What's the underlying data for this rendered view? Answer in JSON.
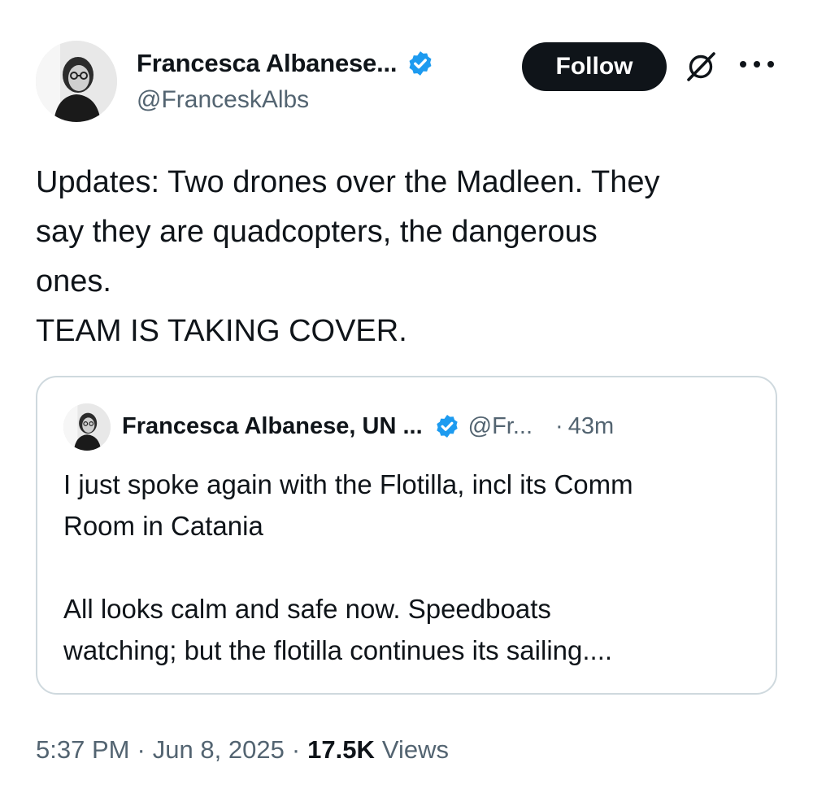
{
  "author": {
    "display_name": "Francesca Albanese...",
    "handle": "@FranceskAlbs",
    "verified": true,
    "verified_color": "#1d9bf0"
  },
  "actions": {
    "follow_label": "Follow",
    "grok_icon": "grok-icon",
    "more_icon": "more-icon"
  },
  "tweet": {
    "text": "Updates: Two drones over the Madleen. They\nsay they are quadcopters, the dangerous\nones.\nTEAM IS TAKING COVER."
  },
  "quote": {
    "display_name": "Francesca Albanese, UN ...",
    "handle": "@Fr...",
    "separator": "·",
    "time": "43m",
    "verified": true,
    "text": "I just spoke again with the Flotilla, incl its Comm\nRoom in Catania\n\nAll looks calm and safe now.  Speedboats\nwatching; but the flotilla continues its sailing...."
  },
  "meta": {
    "time": "5:37 PM",
    "separator": "·",
    "date": "Jun 8, 2025",
    "views_count": "17.5K",
    "views_label": "Views"
  }
}
